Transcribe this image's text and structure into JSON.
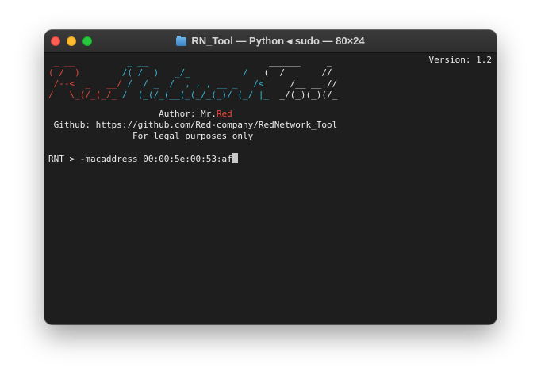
{
  "window": {
    "title": "RN_Tool — Python ◂ sudo — 80×24",
    "icon": "folder-icon"
  },
  "terminal": {
    "version": "Version: 1.2",
    "banner": {
      "line1": {
        "red": " _ __",
        "cyan": "          _ __",
        "white": "                       ______     _"
      },
      "line2": {
        "red": "( /  )",
        "cyan": "        /( /  )   _/_          /",
        "white": "   (  /       //"
      },
      "line3": {
        "red": " /--<  _   __/",
        "cyan": " /  / _  /  , , , __ _   /<",
        "white": "     /__ __ //"
      },
      "line4": {
        "red": "/   \\_(/_(_/_",
        "cyan": " /  (_(/_(__(_(_/_(_)/ (_/ |_",
        "white": "  _/(_)(_)(/_"
      }
    },
    "author_label": "Author: Mr.",
    "author_name": "Red",
    "github": "Github: https://github.com/Red-company/RedNetwork_Tool",
    "legal": "For legal purposes only",
    "prompt": "RNT > ",
    "command": "-macaddress 00:00:5e:00:53:af"
  },
  "colors": {
    "red": "#e8483a",
    "cyan": "#38b6d8",
    "text": "#ececec",
    "background": "#1e1e1e"
  }
}
